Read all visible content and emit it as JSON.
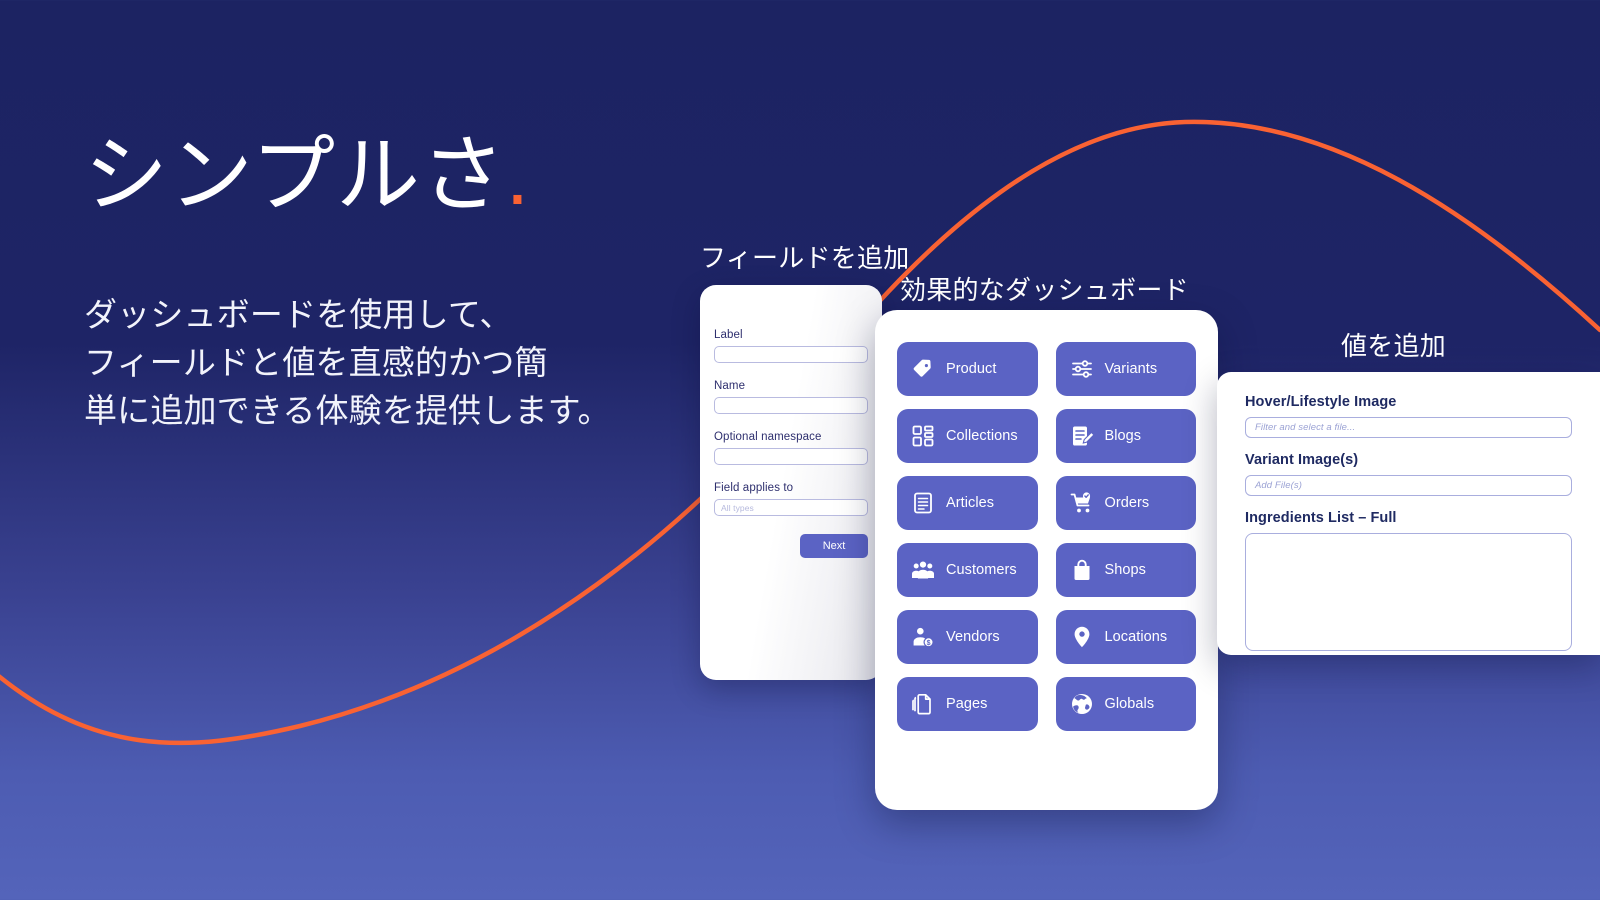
{
  "theme": {
    "bg_top": "#1c2362",
    "bg_bottom": "#5464ba",
    "accent_orange": "#f96233",
    "button_blue": "#5b63c4",
    "card_white": "#ffffff",
    "label_navy": "#1f2a62"
  },
  "hero": {
    "title": "シンプルさ",
    "title_dot": "。",
    "body_lines": [
      "ダッシュボードを使用して、",
      "フィールドと値を直感的かつ簡",
      "単に追加できる体験を提供します。"
    ]
  },
  "field_card": {
    "title": "フィールドを追加",
    "fields": [
      {
        "label": "Label",
        "value": "",
        "placeholder": ""
      },
      {
        "label": "Name",
        "value": "",
        "placeholder": ""
      },
      {
        "label": "Optional namespace",
        "value": "",
        "placeholder": ""
      },
      {
        "label": "Field applies to",
        "value": "",
        "placeholder": "All types"
      }
    ],
    "next_label": "Next"
  },
  "dashboard_card": {
    "title": "効果的なダッシュボード",
    "buttons": [
      {
        "label": "Product",
        "icon": "tag-icon"
      },
      {
        "label": "Variants",
        "icon": "sliders-icon"
      },
      {
        "label": "Collections",
        "icon": "grid-icon"
      },
      {
        "label": "Blogs",
        "icon": "document-pencil-icon"
      },
      {
        "label": "Articles",
        "icon": "article-icon"
      },
      {
        "label": "Orders",
        "icon": "shopping-cart-check-icon"
      },
      {
        "label": "Customers",
        "icon": "people-icon"
      },
      {
        "label": "Shops",
        "icon": "shopping-bag-icon"
      },
      {
        "label": "Vendors",
        "icon": "person-dollar-icon"
      },
      {
        "label": "Locations",
        "icon": "map-pin-icon"
      },
      {
        "label": "Pages",
        "icon": "pages-stack-icon"
      },
      {
        "label": "Globals",
        "icon": "globe-icon"
      }
    ]
  },
  "value_card": {
    "title": "値を追加",
    "fields": [
      {
        "label": "Hover/Lifestyle Image",
        "placeholder": "Filter and select a file...",
        "type": "input"
      },
      {
        "label": "Variant Image(s)",
        "placeholder": "Add File(s)",
        "type": "input"
      },
      {
        "label": "Ingredients List – Full",
        "placeholder": "",
        "type": "textarea"
      }
    ]
  }
}
